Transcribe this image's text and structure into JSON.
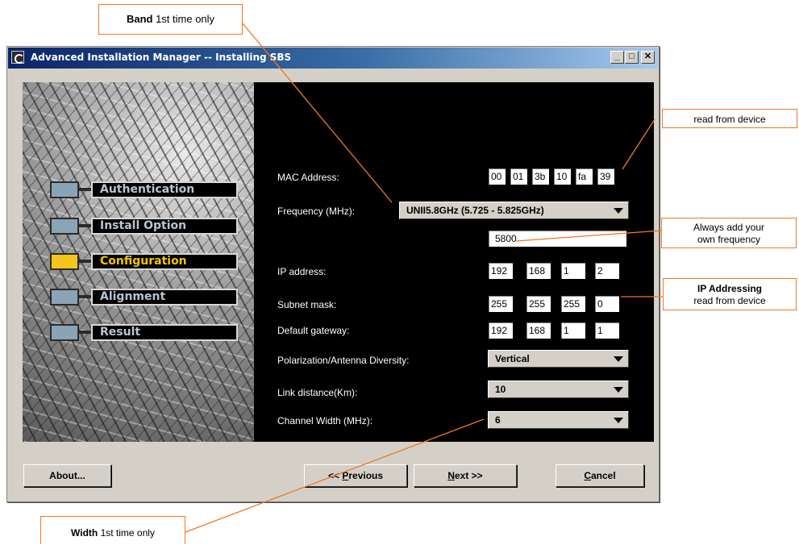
{
  "window": {
    "title": "Advanced Installation Manager -- Installing SBS",
    "controls": {
      "minimize": "_",
      "maximize": "□",
      "close": "✕"
    }
  },
  "steps": [
    {
      "label": "Authentication",
      "state": "done"
    },
    {
      "label": "Install Option",
      "state": "done"
    },
    {
      "label": "Configuration",
      "state": "active"
    },
    {
      "label": "Alignment",
      "state": "pending"
    },
    {
      "label": "Result",
      "state": "pending"
    }
  ],
  "form": {
    "mac": {
      "label": "MAC Address:",
      "octets": [
        "00",
        "01",
        "3b",
        "10",
        "fa",
        "39"
      ]
    },
    "frequency": {
      "label": "Frequency (MHz):",
      "selected": "UNII5.8GHz (5.725 - 5.825GHz)",
      "custom_value": "5800"
    },
    "ip": {
      "label": "IP address:",
      "octets": [
        "192",
        "168",
        "1",
        "2"
      ]
    },
    "subnet": {
      "label": "Subnet mask:",
      "octets": [
        "255",
        "255",
        "255",
        "0"
      ]
    },
    "gateway": {
      "label": "Default gateway:",
      "octets": [
        "192",
        "168",
        "1",
        "1"
      ]
    },
    "polarization": {
      "label": "Polarization/Antenna Diversity:",
      "selected": "Vertical"
    },
    "link_distance": {
      "label": "Link distance(Km):",
      "selected": "10"
    },
    "channel_width": {
      "label": "Channel Width (MHz):",
      "selected": "6"
    }
  },
  "buttons": {
    "about": "About...",
    "previous_prefix": "<< ",
    "previous_mnemonic": "P",
    "previous_rest": "revious",
    "next_mnemonic": "N",
    "next_rest": "ext >>",
    "cancel_mnemonic": "C",
    "cancel_rest": "ancel"
  },
  "callouts": {
    "band": {
      "bold": "Band",
      "text": " 1st time only"
    },
    "read_device": {
      "text": "read from device"
    },
    "frequency": {
      "line1": "Always add your",
      "line2": "own frequency"
    },
    "ip_addressing": {
      "bold": "IP Addressing",
      "text": "read from device"
    },
    "width": {
      "bold": "Width",
      "text": " 1st time only"
    }
  },
  "colors": {
    "callout_border": "#f07820",
    "active_step": "#f5c400",
    "title_bar": "#0a246a"
  }
}
